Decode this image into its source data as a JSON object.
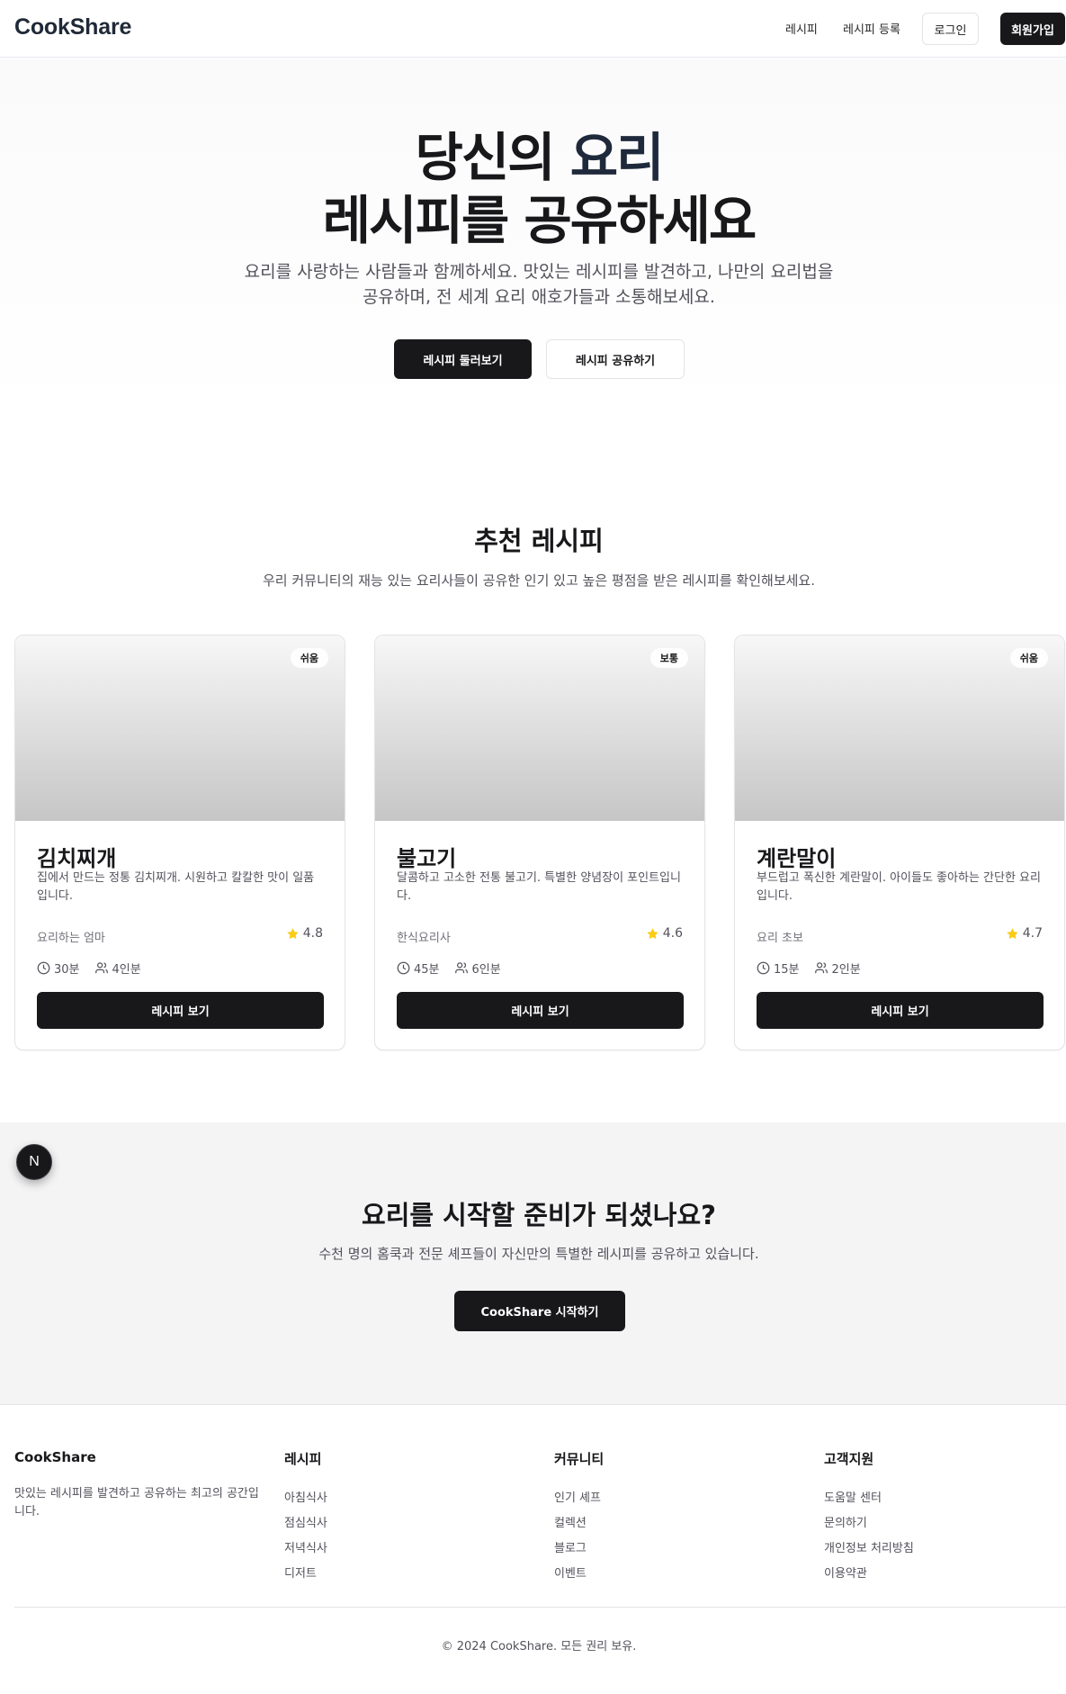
{
  "header": {
    "logo": "CookShare",
    "nav": [
      "레시피",
      "레시피 등록"
    ],
    "login": "로그인",
    "signup": "회원가입"
  },
  "hero": {
    "title_line1_a": "당신의 ",
    "title_line1_b": "요리",
    "title_line2": "레시피를 공유하세요",
    "description": "요리를 사랑하는 사람들과 함께하세요. 맛있는 레시피를 발견하고, 나만의 요리법을 공유하며, 전 세계 요리 애호가들과 소통해보세요.",
    "primary_button": "레시피 둘러보기",
    "secondary_button": "레시피 공유하기"
  },
  "featured": {
    "title": "추천 레시피",
    "subtitle": "우리 커뮤니티의 재능 있는 요리사들이 공유한 인기 있고 높은 평점을 받은 레시피를 확인해보세요.",
    "cards": [
      {
        "difficulty": "쉬움",
        "title": "김치찌개",
        "description": "집에서 만드는 정통 김치찌개. 시원하고 칼칼한 맛이 일품입니다.",
        "author": "요리하는 엄마",
        "rating": "4.8",
        "time": "30분",
        "servings": "4인분",
        "button": "레시피 보기"
      },
      {
        "difficulty": "보통",
        "title": "불고기",
        "description": "달콤하고 고소한 전통 불고기. 특별한 양념장이 포인트입니다.",
        "author": "한식요리사",
        "rating": "4.6",
        "time": "45분",
        "servings": "6인분",
        "button": "레시피 보기"
      },
      {
        "difficulty": "쉬움",
        "title": "계란말이",
        "description": "부드럽고 폭신한 계란말이. 아이들도 좋아하는 간단한 요리입니다.",
        "author": "요리 초보",
        "rating": "4.7",
        "time": "15분",
        "servings": "2인분",
        "button": "레시피 보기"
      }
    ]
  },
  "cta": {
    "title": "요리를 시작할 준비가 되셨나요?",
    "subtitle": "수천 명의 홈쿡과 전문 셰프들이 자신만의 특별한 레시피를 공유하고 있습니다.",
    "button": "CookShare 시작하기",
    "badge": "N"
  },
  "footer": {
    "brand": "CookShare",
    "brand_desc": "맛있는 레시피를 발견하고 공유하는 최고의 공간입니다.",
    "columns": [
      {
        "heading": "레시피",
        "links": [
          "아침식사",
          "점심식사",
          "저녁식사",
          "디저트"
        ]
      },
      {
        "heading": "커뮤니티",
        "links": [
          "인기 셰프",
          "컬렉션",
          "블로그",
          "이벤트"
        ]
      },
      {
        "heading": "고객지원",
        "links": [
          "도움말 센터",
          "문의하기",
          "개인정보 처리방침",
          "이용약관"
        ]
      }
    ],
    "copyright": "© 2024 CookShare. 모든 권리 보유."
  },
  "colors": {
    "primary": "#18181b",
    "star": "#facc15",
    "muted_text": "#52525b"
  }
}
